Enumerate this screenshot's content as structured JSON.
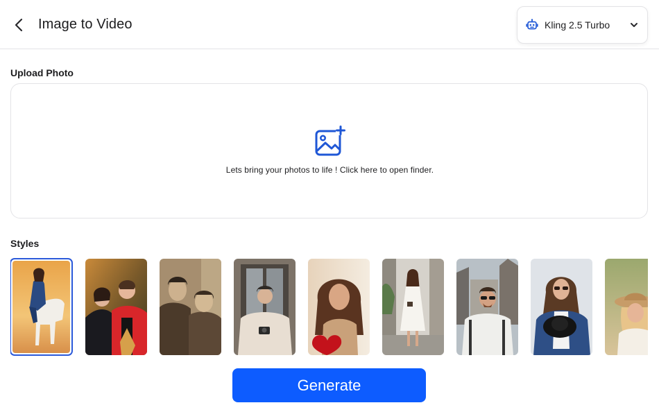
{
  "header": {
    "title": "Image to Video",
    "model_select": {
      "selected": "Kling 2.5 Turbo"
    }
  },
  "upload": {
    "section_label": "Upload Photo",
    "prompt": "Lets bring your photos to life ! Click here to open finder."
  },
  "styles": {
    "section_label": "Styles",
    "items": [
      {
        "name": "horse-rider",
        "selected": true
      },
      {
        "name": "couple-autumn",
        "selected": false
      },
      {
        "name": "vintage-couple",
        "selected": false
      },
      {
        "name": "man-camera",
        "selected": false
      },
      {
        "name": "woman-heart-balloon",
        "selected": false
      },
      {
        "name": "woman-white-dress",
        "selected": false
      },
      {
        "name": "man-sunglasses",
        "selected": false
      },
      {
        "name": "woman-denim-hat",
        "selected": false
      },
      {
        "name": "woman-sunhat",
        "selected": false
      }
    ]
  },
  "actions": {
    "generate_label": "Generate"
  },
  "colors": {
    "accent": "#0d5cff",
    "selected_outline": "#2b59d9",
    "icon_blue": "#1f57d6"
  }
}
